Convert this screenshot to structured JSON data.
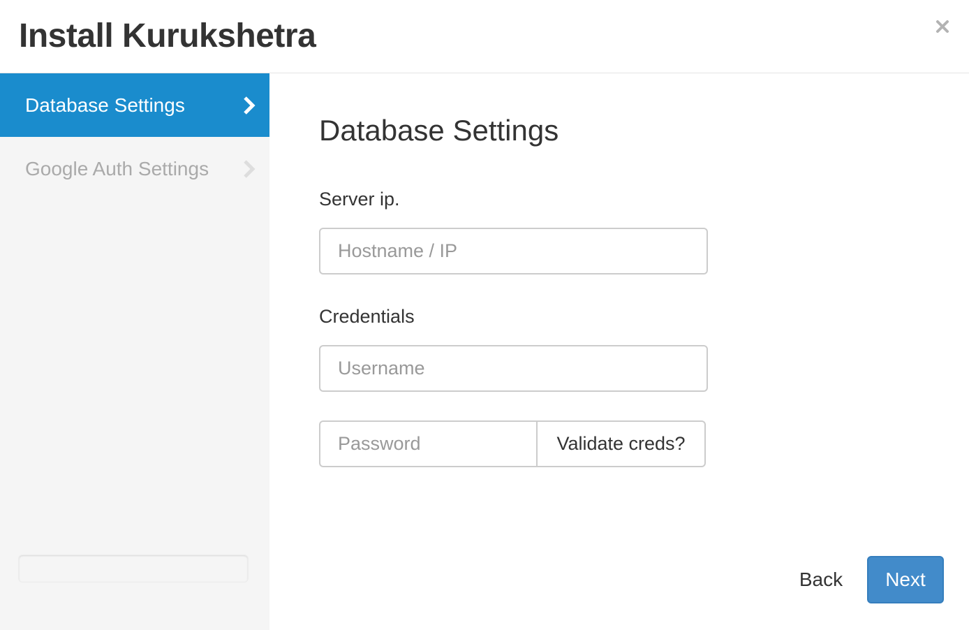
{
  "dialog": {
    "title": "Install Kurukshetra",
    "close_icon": "close-icon"
  },
  "sidebar": {
    "items": [
      {
        "label": "Database Settings",
        "active": true,
        "icon": "chevron-right-icon"
      },
      {
        "label": "Google Auth Settings",
        "active": false,
        "icon": "chevron-right-icon"
      }
    ],
    "progress": 0
  },
  "main": {
    "section_title": "Database Settings",
    "server_label": "Server ip.",
    "hostname_placeholder": "Hostname / IP",
    "hostname_value": "",
    "credentials_label": "Credentials",
    "username_placeholder": "Username",
    "username_value": "",
    "password_placeholder": "Password",
    "password_value": "",
    "validate_label": "Validate creds?"
  },
  "footer": {
    "back_label": "Back",
    "next_label": "Next"
  },
  "colors": {
    "accent": "#1a8ccd",
    "primary_button": "#428bca",
    "sidebar_bg": "#f5f5f5"
  }
}
